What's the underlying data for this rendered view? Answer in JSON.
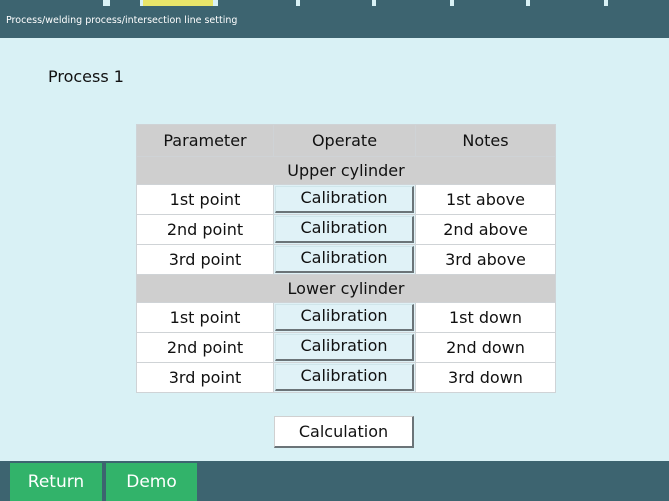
{
  "window": {
    "breadcrumb": "Process/welding process/intersection line setting"
  },
  "process": {
    "label": "Process 1"
  },
  "table": {
    "headers": [
      "Parameter",
      "Operate",
      "Notes"
    ],
    "sections": [
      {
        "title": "Upper cylinder",
        "rows": [
          {
            "parameter": "1st point",
            "operate": "Calibration",
            "notes": "1st above"
          },
          {
            "parameter": "2nd point",
            "operate": "Calibration",
            "notes": "2nd above"
          },
          {
            "parameter": "3rd point",
            "operate": "Calibration",
            "notes": "3rd above"
          }
        ]
      },
      {
        "title": "Lower cylinder",
        "rows": [
          {
            "parameter": "1st point",
            "operate": "Calibration",
            "notes": "1st down"
          },
          {
            "parameter": "2nd point",
            "operate": "Calibration",
            "notes": "2nd down"
          },
          {
            "parameter": "3rd point",
            "operate": "Calibration",
            "notes": "3rd down"
          }
        ]
      }
    ]
  },
  "actions": {
    "calculation_label": "Calculation"
  },
  "footer": {
    "return_label": "Return",
    "demo_label": "Demo"
  },
  "colors": {
    "title_bar": "#3d6470",
    "background": "#d9f1f5",
    "footer_button": "#32b36a",
    "active_tab": "#e8e56a",
    "table_header": "#cfcfcf"
  }
}
